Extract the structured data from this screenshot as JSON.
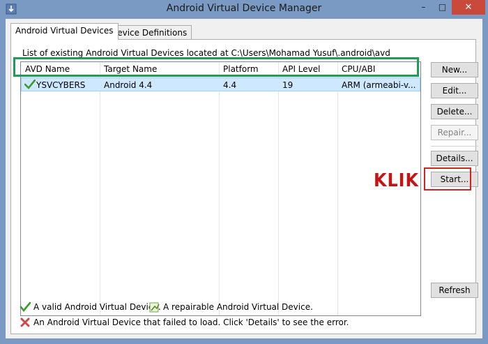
{
  "window": {
    "title": "Android Virtual Device Manager",
    "minimize_glyph": "–",
    "maximize_glyph": "□",
    "close_glyph": "✕"
  },
  "tabs": [
    {
      "label": "Android Virtual Devices",
      "selected": true
    },
    {
      "label": "Device Definitions",
      "selected": false
    }
  ],
  "main": {
    "list_label": "List of existing Android Virtual Devices located at C:\\Users\\Mohamad Yusuf\\.android\\avd",
    "columns": [
      "AVD Name",
      "Target Name",
      "Platform",
      "API Level",
      "CPU/ABI"
    ],
    "rows": [
      {
        "status_icon": "check-icon",
        "avd_name": "YSVCYBERS",
        "target_name": "Android 4.4",
        "platform": "4.4",
        "api_level": "19",
        "cpu_abi": "ARM (armeabi-v..."
      }
    ]
  },
  "buttons": {
    "new": "New...",
    "edit": "Edit...",
    "delete": "Delete...",
    "repair": "Repair...",
    "details": "Details...",
    "start": "Start...",
    "refresh": "Refresh"
  },
  "annotation": {
    "text": "KLIK",
    "color": "#c41515",
    "highlight_row_color": "#1e9e55",
    "highlight_button_color": "#d22222"
  },
  "legend": {
    "valid": "A valid Android Virtual Device.",
    "repairable": "A repairable Android Virtual Device.",
    "failed": "An Android Virtual Device that failed to load. Click 'Details' to see the error."
  },
  "colors": {
    "titlebar": "#7a9ac4",
    "close_button": "#c94a3c",
    "selected_row": "#cde8ff"
  }
}
